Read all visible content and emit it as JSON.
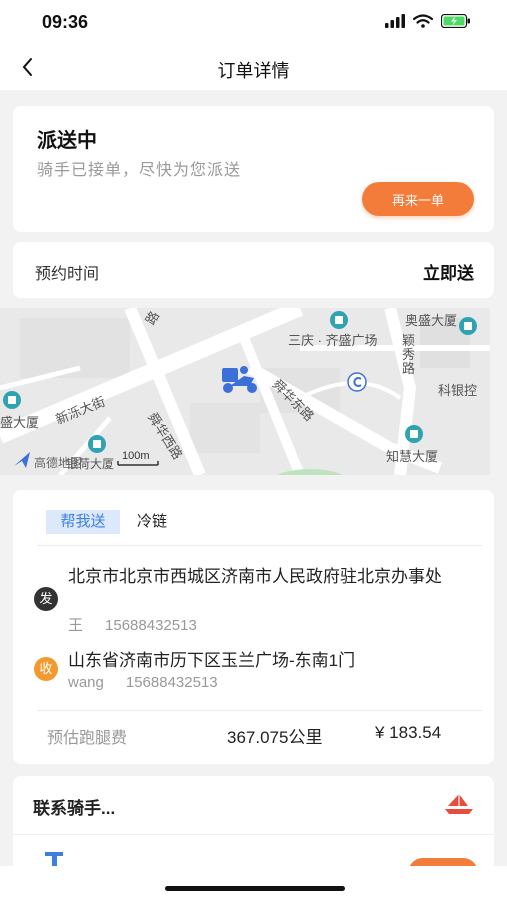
{
  "status_bar": {
    "time": "09:36"
  },
  "nav": {
    "title": "订单详情"
  },
  "order_status": {
    "title": "派送中",
    "subtitle": "骑手已接单，尽快为您派送",
    "again_button": "再来一单"
  },
  "appointment": {
    "label": "预约时间",
    "value": "立即送"
  },
  "map": {
    "labels": {
      "road_1": "路",
      "sanqing": "三庆 · 齐盛广场",
      "aosheng": "奥盛大厦",
      "yingxiu": "颖秀路",
      "kejian": "科银控",
      "sheng": "盛大厦",
      "xinluo": "新泺大街",
      "shunhua_w": "舜华西路",
      "shunhua_e": "舜华东路",
      "zhihui": "知慧大厦",
      "yinhe": "银荷大厦",
      "gaode": "高德地图",
      "scale": "100m"
    },
    "colors": {
      "road": "#ffffff",
      "ground": "#e9e9e9",
      "poi": "#2fa3b3",
      "rider": "#3c6fd8"
    }
  },
  "order": {
    "tabs": [
      {
        "label": "帮我送",
        "active": true
      },
      {
        "label": "冷链",
        "active": false
      }
    ],
    "sender": {
      "badge": "发",
      "address": "北京市北京市西城区济南市人民政府驻北京办事处",
      "name": "王",
      "phone": "15688432513"
    },
    "receiver": {
      "badge": "收",
      "address": "山东省济南市历下区玉兰广场-东南1门",
      "name": "wang",
      "phone": "15688432513"
    },
    "fee": {
      "label": "预估跑腿费",
      "distance": "367.075公里",
      "price": "¥ 183.54"
    }
  },
  "rider": {
    "title": "联系骑手..."
  },
  "colors": {
    "accent": "#f47c3a",
    "tab_blue": "#3d7fe0",
    "tab_bg": "#dbe9fb"
  }
}
